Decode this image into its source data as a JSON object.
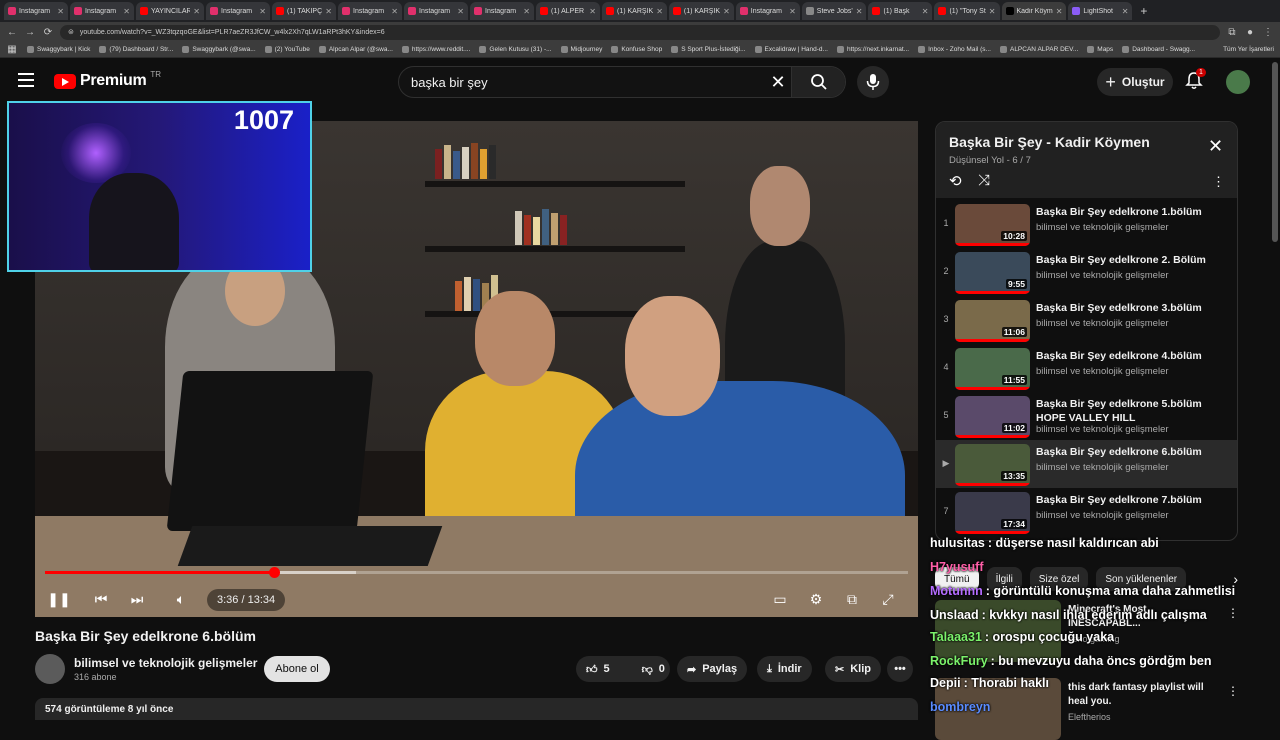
{
  "browser": {
    "tabs": [
      {
        "label": "Instagram",
        "color": "#e1306c"
      },
      {
        "label": "Instagram",
        "color": "#e1306c"
      },
      {
        "label": "YAYINCILAR",
        "color": "#ff0000"
      },
      {
        "label": "Instagram",
        "color": "#e1306c"
      },
      {
        "label": "(1) TAKİPÇ",
        "color": "#ff0000"
      },
      {
        "label": "Instagram",
        "color": "#e1306c"
      },
      {
        "label": "Instagram",
        "color": "#e1306c"
      },
      {
        "label": "Instagram",
        "color": "#e1306c"
      },
      {
        "label": "(1) ALPER",
        "color": "#ff0000"
      },
      {
        "label": "(1) KARŞIK",
        "color": "#ff0000"
      },
      {
        "label": "(1) KARŞIK",
        "color": "#ff0000"
      },
      {
        "label": "Instagram",
        "color": "#e1306c"
      },
      {
        "label": "Steve Jobs'",
        "color": "#888888"
      },
      {
        "label": "(1) Başk",
        "color": "#ff0000"
      },
      {
        "label": "(1) \"Tony St",
        "color": "#ff0000"
      },
      {
        "label": "Kadir Köym",
        "color": "#000000"
      },
      {
        "label": "LightShot",
        "color": "#8a5cf6"
      }
    ],
    "url": "youtube.com/watch?v=_WZ3tqzqoGE&list=PLR7aeZR3JfCW_w4lx2Xh7qLW1aRPt3hKY&index=6",
    "bookmarks": [
      "Swaggybark | Kick",
      "(79) Dashboard / Str...",
      "Swaggybark (@swa...",
      "(2) YouTube",
      "Alpcan Alpar (@swa...",
      "https://www.reddit....",
      "Gelen Kutusu (31) -...",
      "Midjourney",
      "Konfuse Shop",
      "S Sport Plus-İstediği...",
      "Excalidraw | Hand-d...",
      "https://next.inkarnat...",
      "Inbox - Zoho Mail (s...",
      "ALPCAN ALPAR DEV...",
      "Maps",
      "Dashboard - Swagg..."
    ],
    "bookmarks_right": "Tüm Yer İşaretleri"
  },
  "header": {
    "logo_text": "Premium",
    "country": "TR",
    "search_value": "başka bir şey",
    "create_label": "Oluştur",
    "notif_count": "1"
  },
  "overlay": {
    "viewer_count": "1007"
  },
  "player": {
    "time": "3:36 / 13:34",
    "progress_fraction": 0.265,
    "loaded_fraction": 0.36
  },
  "video": {
    "title": "Başka Bir Şey edelkrone 6.bölüm",
    "channel": "bilimsel ve teknolojik gelişmeler",
    "subs": "316 abone",
    "subscribe_label": "Abone ol",
    "likes": "5",
    "dislikes": "0",
    "share_label": "Paylaş",
    "download_label": "İndir",
    "clip_label": "Klip",
    "meta": "574 görüntüleme  8 yıl önce"
  },
  "playlist": {
    "title": "Başka Bir Şey - Kadir Köymen",
    "subtitle": "Düşünsel Yol - 6 / 7",
    "items": [
      {
        "idx": "1",
        "title": "Başka Bir Şey edelkrone 1.bölüm",
        "channel": "bilimsel ve teknolojik gelişmeler",
        "duration": "10:28"
      },
      {
        "idx": "2",
        "title": "Başka Bir Şey edelkrone 2. Bölüm",
        "channel": "bilimsel ve teknolojik gelişmeler",
        "duration": "9:55"
      },
      {
        "idx": "3",
        "title": "Başka Bir Şey edelkrone 3.bölüm",
        "channel": "bilimsel ve teknolojik gelişmeler",
        "duration": "11:06"
      },
      {
        "idx": "4",
        "title": "Başka Bir Şey edelkrone 4.bölüm",
        "channel": "bilimsel ve teknolojik gelişmeler",
        "duration": "11:55"
      },
      {
        "idx": "5",
        "title": "Başka Bir Şey edelkrone 5.bölüm HOPE VALLEY HILL",
        "channel": "bilimsel ve teknolojik gelişmeler",
        "duration": "11:02"
      },
      {
        "idx": "▶",
        "title": "Başka Bir Şey edelkrone 6.bölüm",
        "channel": "bilimsel ve teknolojik gelişmeler",
        "duration": "13:35"
      },
      {
        "idx": "7",
        "title": "Başka Bir Şey edelkrone 7.bölüm",
        "channel": "bilimsel ve teknolojik gelişmeler",
        "duration": "17:34"
      }
    ]
  },
  "chips": [
    "Tümü",
    "İlgili",
    "Size özel",
    "Son yüklenenler"
  ],
  "recommendations": [
    {
      "title": "Minecraft's Most INESCAPABL...",
      "channel": "zeno gaming"
    },
    {
      "title": "this dark fantasy playlist will heal you.",
      "channel": "Eleftherios"
    }
  ],
  "chat": [
    {
      "user": "hulusitas",
      "text": ": düşerse nasıl kaldırıcan abi",
      "color": "#ffffff"
    },
    {
      "user": "H7yusuff",
      "text": "",
      "color": "#ff5fa8"
    },
    {
      "user": "Motunnn",
      "text": ": görüntülü konuşma ama daha zahmetlisi",
      "color": "#b46cff"
    },
    {
      "user": "Unslaad",
      "text": ": kvkkyı nasıl ihlal ederim adlı çalışma",
      "color": "#ffffff"
    },
    {
      "user": "Talaaa31",
      "text": ": orospu çocuğu yaka",
      "color": "#7bf26b"
    },
    {
      "user": "RockFury",
      "text": ": bu mevzuyu daha öncs gördğm ben",
      "color": "#7bf26b"
    },
    {
      "user": "Depii",
      "text": ": Thorabi haklı",
      "color": "#ffffff"
    },
    {
      "user": "bombreyn",
      "text": "",
      "color": "#5a8cff"
    }
  ]
}
